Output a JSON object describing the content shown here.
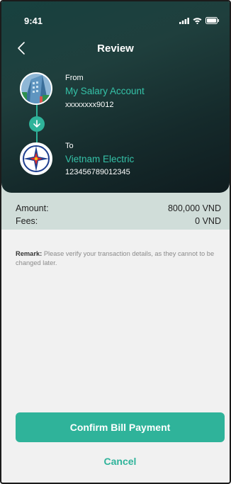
{
  "status_bar": {
    "time": "9:41"
  },
  "header": {
    "title": "Review"
  },
  "from": {
    "label": "From",
    "name": "My Salary Account",
    "number": "xxxxxxxx9012"
  },
  "to": {
    "label": "To",
    "name": "Vietnam Electric",
    "number": "123456789012345"
  },
  "summary": {
    "amount_label": "Amount:",
    "amount_value": "800,000 VND",
    "fees_label": "Fees:",
    "fees_value": "0 VND"
  },
  "remark": {
    "label": "Remark:",
    "text": "Please verify your transaction details, as they cannot to be changed later."
  },
  "actions": {
    "confirm_label": "Confirm Bill Payment",
    "cancel_label": "Cancel"
  },
  "colors": {
    "accent": "#2fb39a",
    "header_dark": "#17413f",
    "summary_bg": "#d0ddd9"
  },
  "icons": {
    "back": "chevron-left-icon",
    "transfer": "arrow-down-icon",
    "signal": "signal-icon",
    "wifi": "wifi-icon",
    "battery": "battery-icon"
  }
}
